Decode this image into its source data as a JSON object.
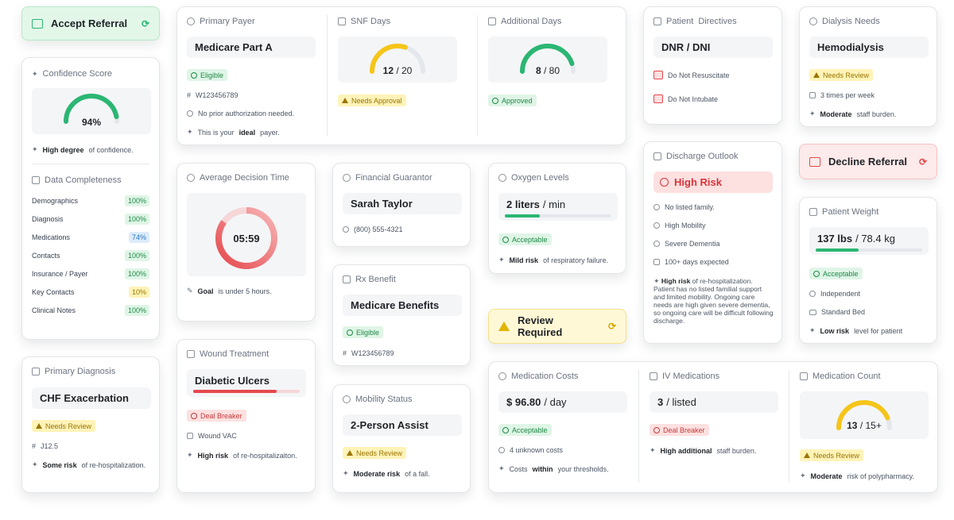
{
  "accept": {
    "label": "Accept Referral"
  },
  "confidence": {
    "title": "Confidence Score",
    "value": 94,
    "display": "94%",
    "note_bold": "High degree",
    "note_rest": "of confidence."
  },
  "completeness": {
    "title": "Data Completeness",
    "rows": [
      {
        "label": "Demographics",
        "value": "100%"
      },
      {
        "label": "Diagnosis",
        "value": "100%"
      },
      {
        "label": "Medications",
        "value": "74%"
      },
      {
        "label": "Contacts",
        "value": "100%"
      },
      {
        "label": "Insurance / Payer",
        "value": "100%"
      },
      {
        "label": "Key Contacts",
        "value": "10%"
      },
      {
        "label": "Clinical Notes",
        "value": "100%"
      }
    ]
  },
  "primary_dx": {
    "title": "Primary Diagnosis",
    "value": "CHF Exacerbation",
    "badge": "Needs Review",
    "code": "J12.5",
    "note_bold": "Some risk",
    "note_rest": "of re-hospitalization."
  },
  "payer": {
    "title": "Primary Payer",
    "value": "Medicare Part A",
    "badge": "Eligible",
    "id": "W123456789",
    "auth": "No prior authorization needed.",
    "note_pre": "This is your",
    "note_bold": "ideal",
    "note_post": "payer."
  },
  "snf": {
    "title": "SNF Days",
    "value": "12",
    "total": "/ 20",
    "badge": "Needs Approval",
    "fraction": 0.6
  },
  "addl": {
    "title": "Additional Days",
    "value": "8",
    "total": "/ 80",
    "badge": "Approved",
    "fraction": 0.9
  },
  "directives": {
    "title": "Patient  Directives",
    "value": "DNR / DNI",
    "items": [
      "Do Not Resuscitate",
      "Do Not Intubate"
    ]
  },
  "dialysis": {
    "title": "Dialysis Needs",
    "value": "Hemodialysis",
    "badge": "Needs Review",
    "freq": "3 times per week",
    "note_bold": "Moderate",
    "note_rest": "staff burden."
  },
  "decision": {
    "title": "Average Decision Time",
    "value": "05:59",
    "note_bold": "Goal",
    "note_rest": "is under 5 hours.",
    "fraction": 0.85
  },
  "guarantor": {
    "title": "Financial Guarantor",
    "value": "Sarah Taylor",
    "phone": "(800) 555-4321"
  },
  "oxygen": {
    "title": "Oxygen Levels",
    "value": "2 liters",
    "unit": "/ min",
    "badge": "Acceptable",
    "note_bold": "Mild risk",
    "note_rest": "of respiratory failure.",
    "fraction": 0.33
  },
  "outlook": {
    "title": "Discharge Outlook",
    "value": "High Risk",
    "items": [
      "No listed family.",
      "High Mobility",
      "Severe Dementia",
      "100+ days expected"
    ],
    "note_bold": "High risk",
    "note_rest": "of re-hospitalization. Patient has no listed familial support and limited mobility. Ongoing care needs are high given severe dementia, so ongoing care will be difficult following discharge."
  },
  "decline": {
    "label": "Decline Referral"
  },
  "weight": {
    "title": "Patient Weight",
    "value": "137 lbs",
    "secondary": "/ 78.4 kg",
    "badge": "Acceptable",
    "mobility": "Independent",
    "bed": "Standard Bed",
    "note_bold": "Low risk",
    "note_rest": "level for patient",
    "fraction": 0.4
  },
  "rx": {
    "title": "Rx Benefit",
    "value": "Medicare Benefits",
    "badge": "Eligible",
    "id": "W123456789"
  },
  "review": {
    "label": "Review Required"
  },
  "wound": {
    "title": "Wound Treatment",
    "value": "Diabetic Ulcers",
    "badge": "Deal Breaker",
    "device": "Wound VAC",
    "note_bold": "High risk",
    "note_rest": "of re-hospitalizaiton.",
    "fraction": 0.78
  },
  "mobility": {
    "title": "Mobility Status",
    "value": "2-Person Assist",
    "badge": "Needs Review",
    "note_bold": "Moderate risk",
    "note_rest": "of a fall."
  },
  "medcost": {
    "title": "Medication Costs",
    "value": "$ 96.80",
    "unit": "/ day",
    "badge": "Acceptable",
    "unknown": "4 unknown costs",
    "note_pre": "Costs",
    "note_bold": "within",
    "note_post": "your thresholds."
  },
  "iv": {
    "title": "IV Medications",
    "value": "3",
    "unit": "/ listed",
    "badge": "Deal Breaker",
    "note_bold": "High additional",
    "note_rest": "staff burden."
  },
  "medcount": {
    "title": "Medication Count",
    "value": "13",
    "total": "/ 15+",
    "badge": "Needs Review",
    "note_bold": "Moderate",
    "note_rest": "risk of polypharmacy.",
    "fraction": 0.87
  },
  "colors": {
    "green": "#2bb673",
    "yellow": "#f5c518",
    "red": "#e5484d"
  }
}
